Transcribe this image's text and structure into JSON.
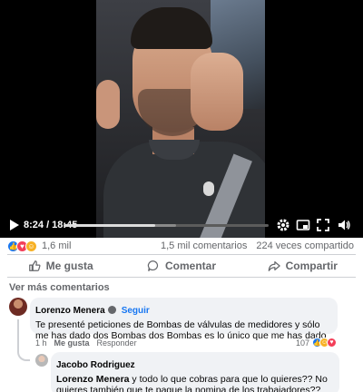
{
  "video": {
    "time_display": "8:24 / 18:45",
    "progress_fraction": 0.448,
    "buffer_fraction": 0.55
  },
  "stats": {
    "reaction_count": "1,6 mil",
    "comments": "1,5 mil comentarios",
    "shares": "224 veces compartido"
  },
  "actions": {
    "like": "Me gusta",
    "comment": "Comentar",
    "share": "Compartir"
  },
  "more_comments": "Ver más comentarios",
  "comments": [
    {
      "author": "Lorenzo Menera",
      "follow": "Seguir",
      "text": "Te presenté peticiones de Bombas de válvulas de medidores y sólo me has dado dos Bombas dos Bombas es lo único que me has dado",
      "time": "1 h",
      "like": "Me gusta",
      "reply": "Responder",
      "reaction_count": "107"
    },
    {
      "author": "Jacobo Rodriguez",
      "mention": "Lorenzo Menera",
      "text": " y todo lo que cobras para que lo quieres?? No quieres también que te pague la nomina de los trabajadores?? No tienes vergüenza. Ponte a jalar y deja de llorar!!"
    }
  ],
  "colors": {
    "accent": "#1877f2",
    "secondary_text": "#65676b",
    "bubble": "#f0f2f5",
    "divider": "#ced0d4"
  },
  "icons": {
    "play": "play-icon",
    "settings": "gear-icon",
    "fullscreen": "fullscreen-icon",
    "volume": "volume-icon"
  }
}
